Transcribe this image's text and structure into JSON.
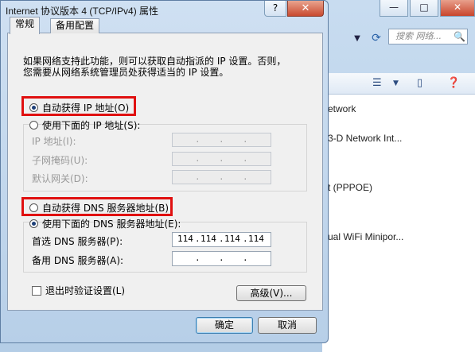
{
  "background_window": {
    "controls": [
      "—",
      "□",
      "✕"
    ],
    "search_placeholder": "搜索 网络...",
    "items": [
      "etwork",
      "3-D Network Int...",
      "t (PPPOE)",
      "ual WiFi Minipor..."
    ]
  },
  "dialog": {
    "title": "Internet 协议版本 4 (TCP/IPv4) 属性",
    "help": "?",
    "close": "✕",
    "tabs": [
      "常规",
      "备用配置"
    ],
    "description": "如果网络支持此功能，则可以获取自动指派的 IP 设置。否则，您需要从网络系统管理员处获得适当的 IP 设置。",
    "ip_auto": "自动获得 IP 地址(O)",
    "ip_manual": "使用下面的 IP 地址(S):",
    "ip_fields": {
      "ip": "IP 地址(I):",
      "mask": "子网掩码(U):",
      "gateway": "默认网关(D):"
    },
    "dns_auto": "自动获得 DNS 服务器地址(B)",
    "dns_manual": "使用下面的 DNS 服务器地址(E):",
    "dns_fields": {
      "preferred_label": "首选 DNS 服务器(P):",
      "preferred_value": [
        "114",
        "114",
        "114",
        "114"
      ],
      "alternate_label": "备用 DNS 服务器(A):"
    },
    "validate_on_exit": "退出时验证设置(L)",
    "advanced": "高级(V)...",
    "ok": "确定",
    "cancel": "取消"
  },
  "colors": {
    "highlight_box": "#e01010",
    "dialog_frame": "#b7cfe8"
  }
}
